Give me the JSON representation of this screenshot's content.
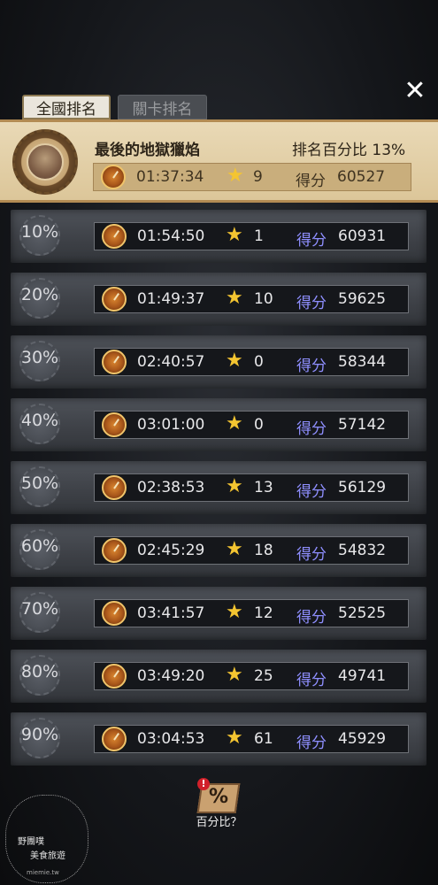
{
  "tabs": {
    "national": "全國排名",
    "stage": "關卡排名"
  },
  "close_glyph": "✕",
  "player": {
    "level_name": "最後的地獄獵焰",
    "percentile_label": "排名百分比",
    "percentile_value": "13%",
    "time": "01:37:34",
    "stars": "9",
    "score_label": "得分",
    "score": "60527"
  },
  "rows": [
    {
      "pct": "10%",
      "time": "01:54:50",
      "stars": "1",
      "score_label": "得分",
      "score": "60931"
    },
    {
      "pct": "20%",
      "time": "01:49:37",
      "stars": "10",
      "score_label": "得分",
      "score": "59625"
    },
    {
      "pct": "30%",
      "time": "02:40:57",
      "stars": "0",
      "score_label": "得分",
      "score": "58344"
    },
    {
      "pct": "40%",
      "time": "03:01:00",
      "stars": "0",
      "score_label": "得分",
      "score": "57142"
    },
    {
      "pct": "50%",
      "time": "02:38:53",
      "stars": "13",
      "score_label": "得分",
      "score": "56129"
    },
    {
      "pct": "60%",
      "time": "02:45:29",
      "stars": "18",
      "score_label": "得分",
      "score": "54832"
    },
    {
      "pct": "70%",
      "time": "03:41:57",
      "stars": "12",
      "score_label": "得分",
      "score": "52525"
    },
    {
      "pct": "80%",
      "time": "03:49:20",
      "stars": "25",
      "score_label": "得分",
      "score": "49741"
    },
    {
      "pct": "90%",
      "time": "03:04:53",
      "stars": "61",
      "score_label": "得分",
      "score": "45929"
    }
  ],
  "hint": {
    "symbol": "%",
    "badge": "!",
    "label": "百分比？"
  },
  "watermark": {
    "line1": "野團噗",
    "line2": "美食旅遊",
    "url": "miemie.tw"
  },
  "icons": {
    "stopwatch": "stopwatch-icon",
    "star": "star-icon",
    "close": "close-icon"
  },
  "colors": {
    "accent_gold": "#f4c531",
    "score_label": "#8f8fff",
    "header_bg": "#e9d9b6"
  }
}
